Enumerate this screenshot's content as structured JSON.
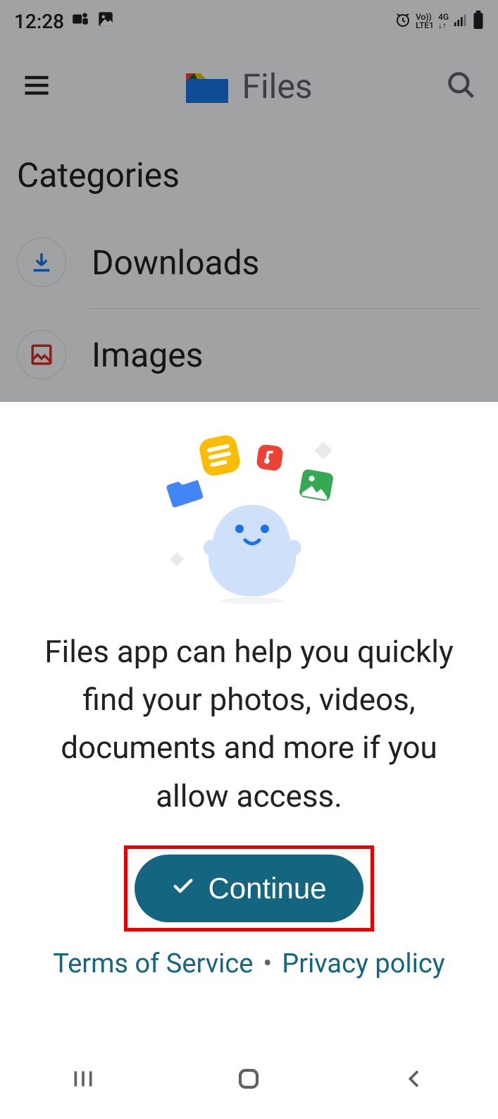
{
  "status": {
    "time": "12:28",
    "network_label": "LTE1",
    "network_gen": "4G",
    "vo": "Vo))"
  },
  "appbar": {
    "title": "Files"
  },
  "categories": {
    "header": "Categories",
    "items": [
      {
        "label": "Downloads"
      },
      {
        "label": "Images"
      }
    ]
  },
  "sheet": {
    "message": "Files app can help you quickly find your photos, videos, documents and more if you allow access.",
    "continue_label": "Continue",
    "tos_label": "Terms of Service",
    "privacy_label": "Privacy policy"
  }
}
